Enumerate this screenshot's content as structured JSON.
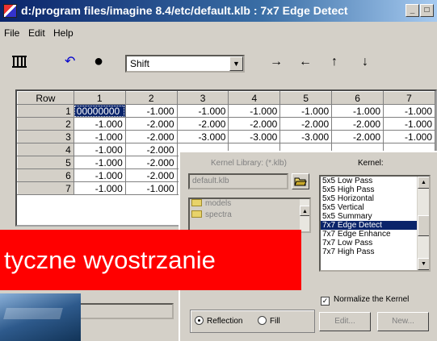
{
  "window": {
    "title": "d:/program files/imagine 8.4/etc/default.klb : 7x7 Edge Detect",
    "min_label": "_",
    "max_label": "□"
  },
  "menu": [
    "File",
    "Edit",
    "Help"
  ],
  "toolbar": {
    "icons": [
      "columns-icon",
      "undo-icon",
      "circle-icon"
    ],
    "combo_value": "Shift",
    "arrows": [
      "→",
      "←",
      "↑",
      "↓"
    ]
  },
  "grid": {
    "corner": "Row",
    "columns": [
      "1",
      "2",
      "3",
      "4",
      "5",
      "6",
      "7"
    ],
    "rows": [
      {
        "row": "1",
        "cells": [
          "00000000",
          "-1.000",
          "-1.000",
          "-1.000",
          "-1.000",
          "-1.000",
          "-1.000"
        ]
      },
      {
        "row": "2",
        "cells": [
          "-1.000",
          "-2.000",
          "-2.000",
          "-2.000",
          "-2.000",
          "-2.000",
          "-1.000"
        ]
      },
      {
        "row": "3",
        "cells": [
          "-1.000",
          "-2.000",
          "-3.000",
          "-3.000",
          "-3.000",
          "-2.000",
          "-1.000"
        ]
      },
      {
        "row": "4",
        "cells": [
          "-1.000",
          "-2.000",
          "",
          "",
          "",
          "",
          ""
        ]
      },
      {
        "row": "5",
        "cells": [
          "-1.000",
          "-2.000",
          "",
          "",
          "",
          "",
          ""
        ]
      },
      {
        "row": "6",
        "cells": [
          "-1.000",
          "-2.000",
          "",
          "",
          "",
          "",
          ""
        ]
      },
      {
        "row": "7",
        "cells": [
          "-1.000",
          "-1.000",
          "",
          "",
          "",
          "",
          ""
        ]
      }
    ]
  },
  "dialog": {
    "library_label": "Kernel Library: (*.klb)",
    "library_value": "default.klb",
    "dirs": [
      "models",
      "spectra"
    ],
    "kernel_label": "Kernel:",
    "kernels": [
      "5x5 Low Pass",
      "5x5 High Pass",
      "5x5 Horizontal",
      "5x5 Vertical",
      "5x5 Summary",
      "7x7 Edge Detect",
      "7x7 Edge Enhance",
      "7x7 Low Pass",
      "7x7 High Pass"
    ],
    "selected_kernel": "7x7 Edge Detect",
    "normalize_label": "Normalize the Kernel",
    "normalize_checked": true,
    "radio_reflection": "Reflection",
    "radio_fill": "Fill",
    "edit_button": "Edit...",
    "new_button": "New..."
  },
  "banner": {
    "text": "tyczne wyostrzanie"
  }
}
